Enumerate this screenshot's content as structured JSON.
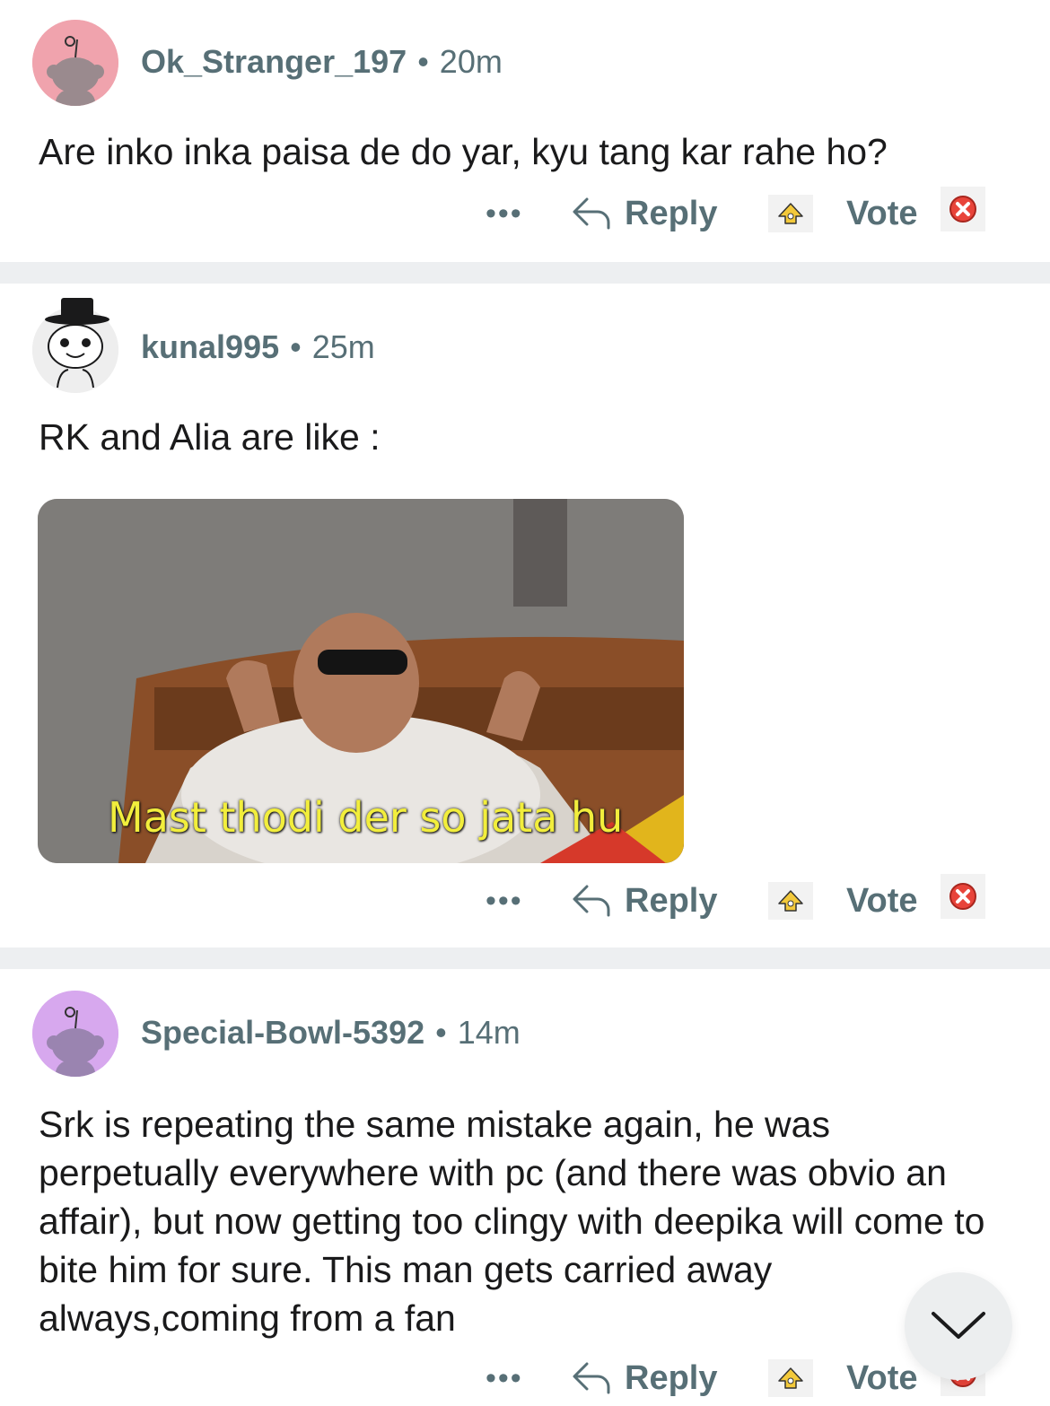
{
  "comments": [
    {
      "username": "Ok_Stranger_197",
      "time": "20m",
      "body": "Are inko inka paisa de do yar, kyu tang kar rahe ho?",
      "avatar_color": "#f0a3ad"
    },
    {
      "username": "kunal995",
      "time": "25m",
      "body": "RK and Alia are like :",
      "gif_caption": "Mast thodi der so jata hu",
      "avatar_color": "#eeeeee"
    },
    {
      "username": "Special-Bowl-5392",
      "time": "14m",
      "body": "Srk is repeating the same mistake again, he was perpetually everywhere with pc (and there was obvio an affair), but now getting too clingy with deepika will come to bite him for sure. This man gets carried away always,coming from a fan",
      "avatar_color": "#d7a8ee"
    }
  ],
  "actions": {
    "more_label": "•••",
    "reply_label": "Reply",
    "vote_label": "Vote"
  },
  "separator": "•",
  "icons": {
    "more": "more-dots-icon",
    "reply": "reply-arrow-icon",
    "upvote": "upvote-award-icon",
    "downvote": "downvote-x-icon",
    "scroll": "chevron-down-icon"
  },
  "colors": {
    "meta_text": "#576f76",
    "divider": "#edeff1",
    "caption": "#f2ee3c",
    "downvote_red": "#e8443a",
    "upvote_yellow": "#f3c93b"
  }
}
